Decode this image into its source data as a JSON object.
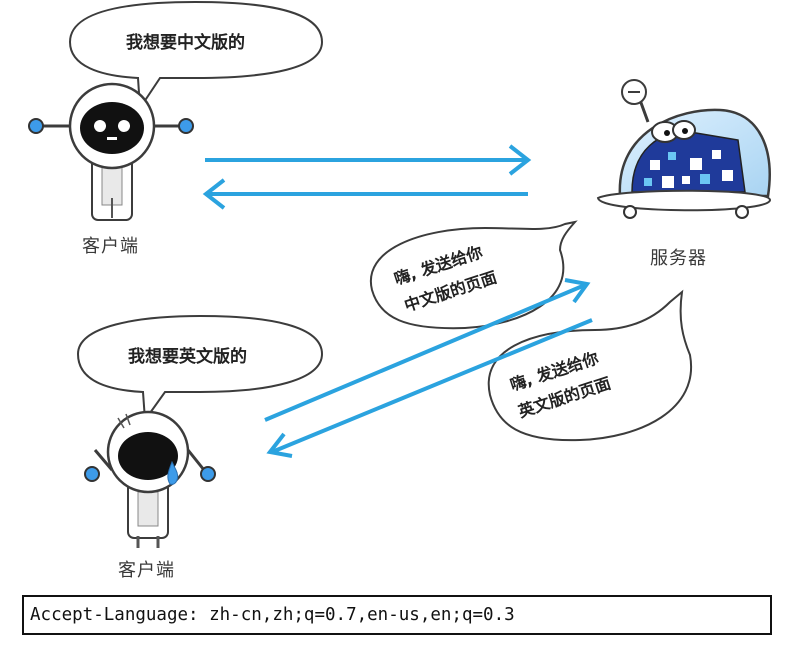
{
  "client_top": {
    "label": "客户端",
    "speech": "我想要中文版的"
  },
  "client_bottom": {
    "label": "客户端",
    "speech": "我想要英文版的"
  },
  "server": {
    "label": "服务器",
    "reply_chinese": [
      "嗨, 发送给你",
      "中文版的页面"
    ],
    "reply_english": [
      "嗨, 发送给你",
      "英文版的页面"
    ]
  },
  "request_header": "Accept-Language: zh-cn,zh;q=0.7,en-us,en;q=0.3",
  "colors": {
    "arrow": "#2ba3df",
    "outline": "#3c3c3c",
    "robot_face": "#111111",
    "robot_accent": "#3d9be9",
    "server_screen": "#1f3a9a"
  }
}
